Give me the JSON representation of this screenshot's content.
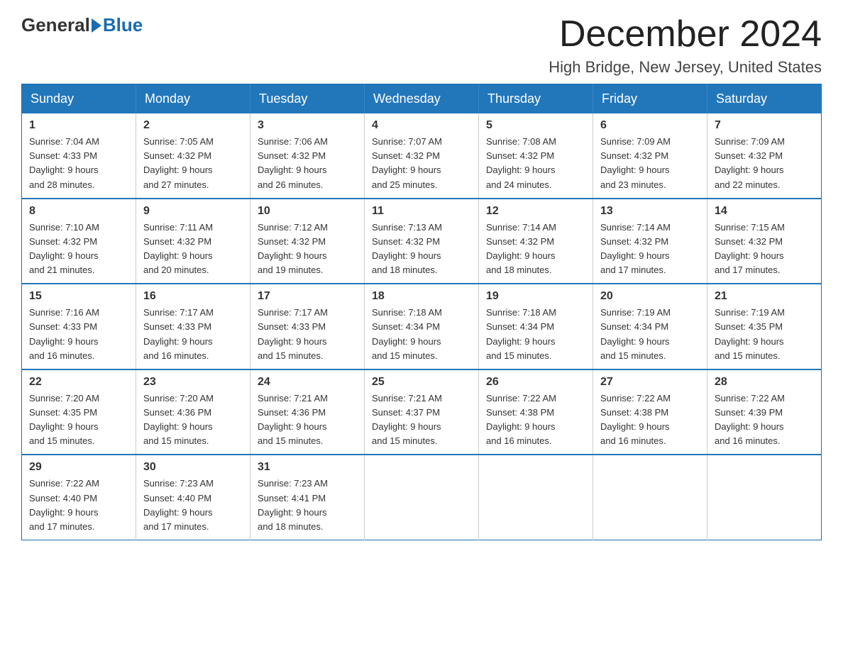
{
  "header": {
    "logo_general": "General",
    "logo_blue": "Blue",
    "month_title": "December 2024",
    "location": "High Bridge, New Jersey, United States"
  },
  "days_of_week": [
    "Sunday",
    "Monday",
    "Tuesday",
    "Wednesday",
    "Thursday",
    "Friday",
    "Saturday"
  ],
  "weeks": [
    [
      {
        "day": "1",
        "sunrise": "7:04 AM",
        "sunset": "4:33 PM",
        "daylight": "9 hours and 28 minutes."
      },
      {
        "day": "2",
        "sunrise": "7:05 AM",
        "sunset": "4:32 PM",
        "daylight": "9 hours and 27 minutes."
      },
      {
        "day": "3",
        "sunrise": "7:06 AM",
        "sunset": "4:32 PM",
        "daylight": "9 hours and 26 minutes."
      },
      {
        "day": "4",
        "sunrise": "7:07 AM",
        "sunset": "4:32 PM",
        "daylight": "9 hours and 25 minutes."
      },
      {
        "day": "5",
        "sunrise": "7:08 AM",
        "sunset": "4:32 PM",
        "daylight": "9 hours and 24 minutes."
      },
      {
        "day": "6",
        "sunrise": "7:09 AM",
        "sunset": "4:32 PM",
        "daylight": "9 hours and 23 minutes."
      },
      {
        "day": "7",
        "sunrise": "7:09 AM",
        "sunset": "4:32 PM",
        "daylight": "9 hours and 22 minutes."
      }
    ],
    [
      {
        "day": "8",
        "sunrise": "7:10 AM",
        "sunset": "4:32 PM",
        "daylight": "9 hours and 21 minutes."
      },
      {
        "day": "9",
        "sunrise": "7:11 AM",
        "sunset": "4:32 PM",
        "daylight": "9 hours and 20 minutes."
      },
      {
        "day": "10",
        "sunrise": "7:12 AM",
        "sunset": "4:32 PM",
        "daylight": "9 hours and 19 minutes."
      },
      {
        "day": "11",
        "sunrise": "7:13 AM",
        "sunset": "4:32 PM",
        "daylight": "9 hours and 18 minutes."
      },
      {
        "day": "12",
        "sunrise": "7:14 AM",
        "sunset": "4:32 PM",
        "daylight": "9 hours and 18 minutes."
      },
      {
        "day": "13",
        "sunrise": "7:14 AM",
        "sunset": "4:32 PM",
        "daylight": "9 hours and 17 minutes."
      },
      {
        "day": "14",
        "sunrise": "7:15 AM",
        "sunset": "4:32 PM",
        "daylight": "9 hours and 17 minutes."
      }
    ],
    [
      {
        "day": "15",
        "sunrise": "7:16 AM",
        "sunset": "4:33 PM",
        "daylight": "9 hours and 16 minutes."
      },
      {
        "day": "16",
        "sunrise": "7:17 AM",
        "sunset": "4:33 PM",
        "daylight": "9 hours and 16 minutes."
      },
      {
        "day": "17",
        "sunrise": "7:17 AM",
        "sunset": "4:33 PM",
        "daylight": "9 hours and 15 minutes."
      },
      {
        "day": "18",
        "sunrise": "7:18 AM",
        "sunset": "4:34 PM",
        "daylight": "9 hours and 15 minutes."
      },
      {
        "day": "19",
        "sunrise": "7:18 AM",
        "sunset": "4:34 PM",
        "daylight": "9 hours and 15 minutes."
      },
      {
        "day": "20",
        "sunrise": "7:19 AM",
        "sunset": "4:34 PM",
        "daylight": "9 hours and 15 minutes."
      },
      {
        "day": "21",
        "sunrise": "7:19 AM",
        "sunset": "4:35 PM",
        "daylight": "9 hours and 15 minutes."
      }
    ],
    [
      {
        "day": "22",
        "sunrise": "7:20 AM",
        "sunset": "4:35 PM",
        "daylight": "9 hours and 15 minutes."
      },
      {
        "day": "23",
        "sunrise": "7:20 AM",
        "sunset": "4:36 PM",
        "daylight": "9 hours and 15 minutes."
      },
      {
        "day": "24",
        "sunrise": "7:21 AM",
        "sunset": "4:36 PM",
        "daylight": "9 hours and 15 minutes."
      },
      {
        "day": "25",
        "sunrise": "7:21 AM",
        "sunset": "4:37 PM",
        "daylight": "9 hours and 15 minutes."
      },
      {
        "day": "26",
        "sunrise": "7:22 AM",
        "sunset": "4:38 PM",
        "daylight": "9 hours and 16 minutes."
      },
      {
        "day": "27",
        "sunrise": "7:22 AM",
        "sunset": "4:38 PM",
        "daylight": "9 hours and 16 minutes."
      },
      {
        "day": "28",
        "sunrise": "7:22 AM",
        "sunset": "4:39 PM",
        "daylight": "9 hours and 16 minutes."
      }
    ],
    [
      {
        "day": "29",
        "sunrise": "7:22 AM",
        "sunset": "4:40 PM",
        "daylight": "9 hours and 17 minutes."
      },
      {
        "day": "30",
        "sunrise": "7:23 AM",
        "sunset": "4:40 PM",
        "daylight": "9 hours and 17 minutes."
      },
      {
        "day": "31",
        "sunrise": "7:23 AM",
        "sunset": "4:41 PM",
        "daylight": "9 hours and 18 minutes."
      },
      null,
      null,
      null,
      null
    ]
  ],
  "labels": {
    "sunrise": "Sunrise:",
    "sunset": "Sunset:",
    "daylight": "Daylight:"
  }
}
